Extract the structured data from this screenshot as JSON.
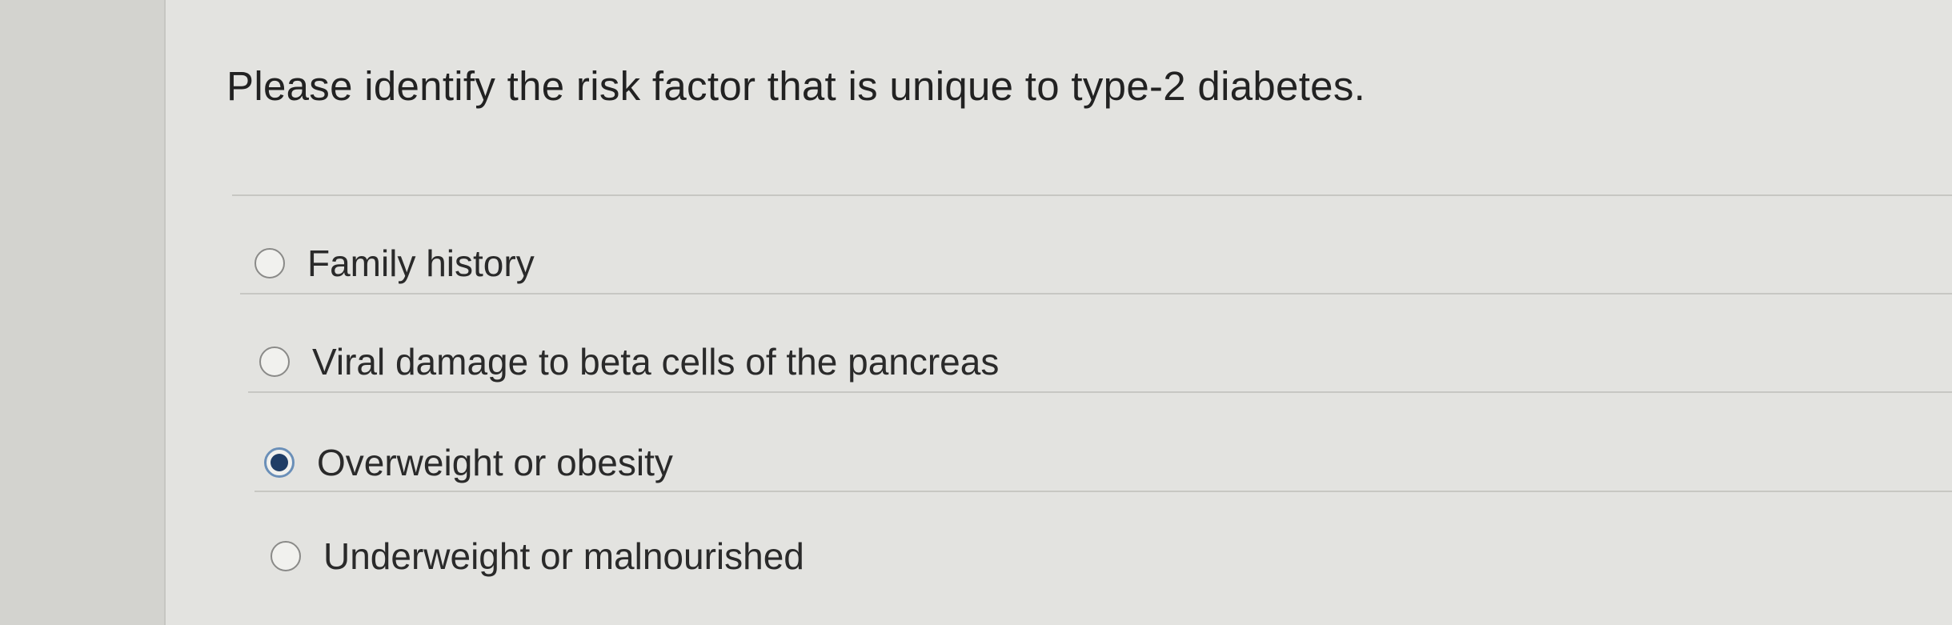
{
  "question": {
    "text": "Please identify the risk factor that is unique to type-2 diabetes."
  },
  "options": [
    {
      "label": "Family history",
      "selected": false
    },
    {
      "label": "Viral damage to beta cells of the pancreas",
      "selected": false
    },
    {
      "label": "Overweight or obesity",
      "selected": true
    },
    {
      "label": "Underweight or malnourished",
      "selected": false
    }
  ],
  "colors": {
    "background": "#e3e3e0",
    "text": "#222222",
    "radio_selected_fill": "#1f3d66",
    "radio_selected_ring": "#6a8fb8",
    "divider": "#c7c7c3"
  }
}
